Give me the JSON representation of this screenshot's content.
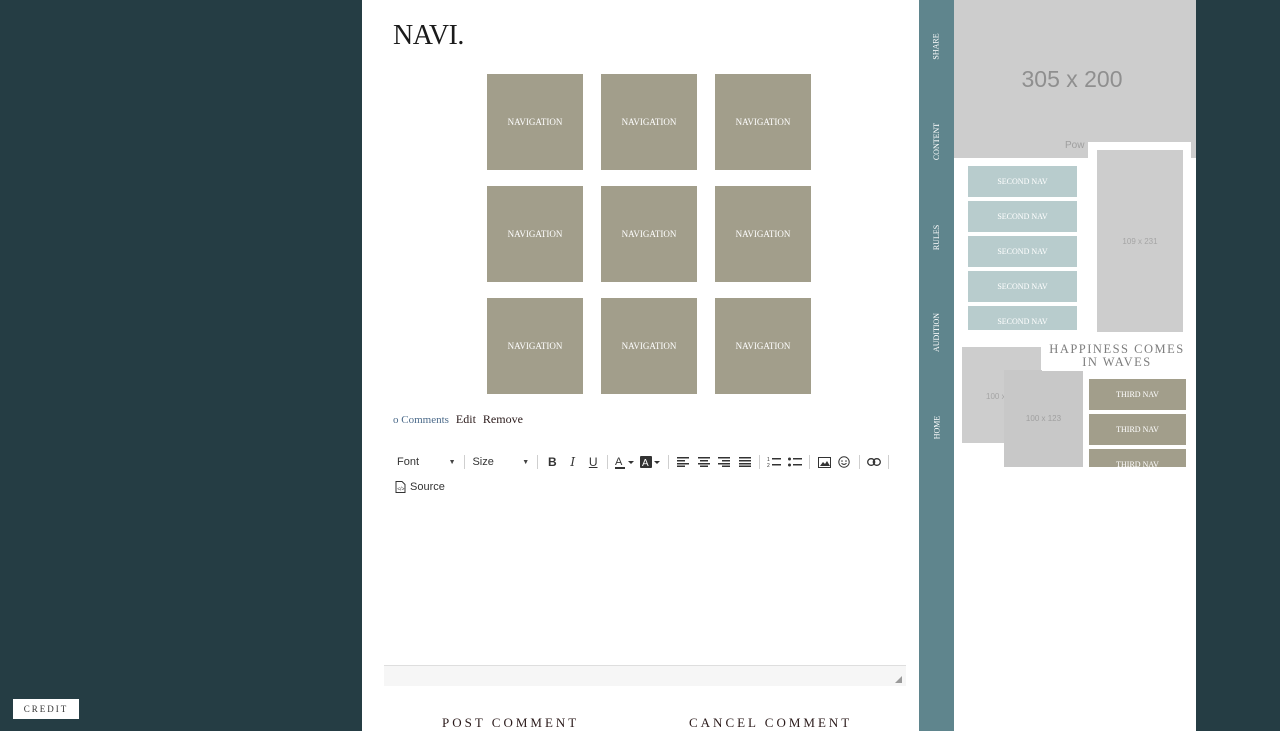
{
  "main": {
    "title": "NAVI.",
    "nav_tiles": [
      "NAVIGATION",
      "NAVIGATION",
      "NAVIGATION",
      "NAVIGATION",
      "NAVIGATION",
      "NAVIGATION",
      "NAVIGATION",
      "NAVIGATION",
      "NAVIGATION"
    ],
    "meta": {
      "comments": "o Comments",
      "edit": "Edit",
      "remove": "Remove"
    },
    "editor": {
      "font_label": "Font",
      "size_label": "Size",
      "source_label": "Source"
    },
    "post_button": "POST COMMENT",
    "cancel_button": "CANCEL COMMENT"
  },
  "vertical_nav": [
    "SHARE",
    "CONTENT",
    "RULES",
    "AUDITION",
    "HOME"
  ],
  "sidebar": {
    "banner_size": "305 x 200",
    "banner_powered": "Pow",
    "tall_placeholder": "109 x 231",
    "second_nav": [
      "SECOND NAV",
      "SECOND NAV",
      "SECOND NAV",
      "SECOND NAV",
      "SECOND NAV"
    ],
    "tagline": "HAPPINESS COMES IN WAVES",
    "small_placeholder_1": "100 x",
    "small_placeholder_2": "100 x 123",
    "third_nav": [
      "THIRD NAV",
      "THIRD NAV",
      "THIRD NAV"
    ]
  },
  "credit": "CREDIT",
  "colors": {
    "background": "#253d44",
    "tile": "#a29e8b",
    "vnav": "#5f858d",
    "second_nav": "#b8cccd"
  }
}
